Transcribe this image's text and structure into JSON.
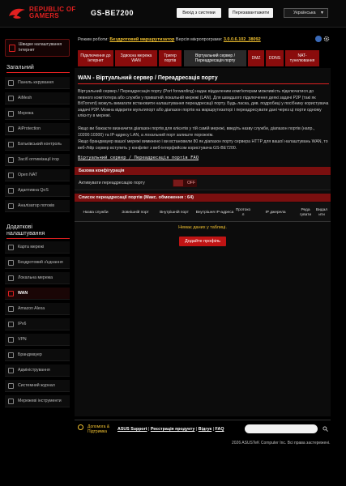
{
  "header": {
    "brand_line1": "REPUBLIC OF",
    "brand_line2": "GAMERS",
    "model": "GS-BE7200",
    "logout": "Вихід з системи",
    "reboot": "Перезавантажити",
    "language": "Українська",
    "accent": "#e02020"
  },
  "sidebar": {
    "quick_setup": "Швидке налаштування Інтернет",
    "general_title": "Загальний",
    "general": [
      {
        "label": "Панель керування",
        "icon": "dashboard-icon"
      },
      {
        "label": "AiMesh",
        "icon": "mesh-icon"
      },
      {
        "label": "Мережа",
        "icon": "network-icon"
      },
      {
        "label": "AiProtection",
        "icon": "shield-icon"
      },
      {
        "label": "Батьківський контроль",
        "icon": "parental-icon"
      },
      {
        "label": "Засіб оптимізації ігор",
        "icon": "gamepad-icon"
      },
      {
        "label": "Open NAT",
        "icon": "nat-icon"
      },
      {
        "label": "Адаптивна QoS",
        "icon": "qos-icon"
      },
      {
        "label": "Аналізатор потоків",
        "icon": "traffic-icon"
      }
    ],
    "advanced_title_1": "Додаткові",
    "advanced_title_2": "налаштування",
    "advanced": [
      {
        "label": "Карта мережі",
        "icon": "map-icon"
      },
      {
        "label": "Бездротовий з'єднання",
        "icon": "wireless-icon"
      },
      {
        "label": "Локальна мережа",
        "icon": "lan-icon"
      },
      {
        "label": "WAN",
        "icon": "globe-icon",
        "active": true
      },
      {
        "label": "Amazon Alexa",
        "icon": "alexa-icon"
      },
      {
        "label": "IPv6",
        "icon": "ipv6-icon"
      },
      {
        "label": "VPN",
        "icon": "vpn-icon"
      },
      {
        "label": "Брандмауер",
        "icon": "firewall-icon"
      },
      {
        "label": "Адміністрування",
        "icon": "admin-icon"
      },
      {
        "label": "Системний журнал",
        "icon": "log-icon"
      },
      {
        "label": "Мережеві інструменти",
        "icon": "tools-icon"
      }
    ]
  },
  "info": {
    "mode_label": "Режим роботи:",
    "mode_value": "Бездротовий маршрутизатор",
    "fw_label": "Версія мікропрограми:",
    "fw_value": "3.0.0.6.102_38092"
  },
  "tabs": [
    {
      "label": "Підключення до Інтернет"
    },
    {
      "label": "Здвоєна мережа WAN"
    },
    {
      "label": "Тригер портів"
    },
    {
      "label": "Віртуальний сервер / Переадресація порту",
      "active": true
    },
    {
      "label": "DMZ"
    },
    {
      "label": "DDNS"
    },
    {
      "label": "NAT-тунелювання"
    }
  ],
  "main": {
    "title": "WAN - Віртуальний сервер / Переадресація порту",
    "desc1": "Віртуальний сервер / Переадресація порту (Port forwarding) надає віддаленим комп'ютерам можливість підключатися до певного комп'ютера або служби у приватній локальній мережі (LAN). Для швидшого підключення деякі задачі P2P (такі як BitTorrent) можуть вимагати встановити налаштування переадресації порту. Будь ласка, див. подробиці у посібнику користувача задачі P2P. Можна відкрити мультипорт або діапазон портів на маршрутизаторі і переадресувати дані через ці порти одному клієнту в мережі.",
    "desc2": "Якщо ви бажаєте визначити діапазон портів для клієнтів у тій самій мережі, введіть назву служби, діапазон портів (напр., 10200:10300) та IP-адресу LAN, а локальний порт залиште порожнім.",
    "desc3": "Якщо брандмауер вашої мережі вимкнено і ви встановили 80 як діапазон порту сервера HTTP для вашої налаштувань WAN, то веб-/http сервер вступить у конфлікт з веб-інтерфейсом користувача GS-BE7200.",
    "faq": "Віртуальний сервер / Переадресація портів FAQ",
    "basic_config": "Базова конфігурація",
    "enable_label": "Активувати переадресацію порту",
    "toggle_state": "OFF",
    "list_title": "Список переадресації портів (Макс. обмеження : 64)",
    "columns": [
      "Назва служби",
      "Зовнішній порт",
      "Внутрішній порт",
      "Внутрішня IP-адреса",
      "Протоко л",
      "IP джерела",
      "Реда гувати",
      "Видал ити"
    ],
    "no_data": "Немає даних у таблиці.",
    "add_profile": "Додайте профіль"
  },
  "footer": {
    "help": "Допомога & Підтримка",
    "links": [
      "ASUS Support",
      "Реєстрація продукту",
      "Відгук",
      "FAQ"
    ],
    "copyright": "2026 ASUSTeK Computer Inc. Всі права застережені."
  }
}
